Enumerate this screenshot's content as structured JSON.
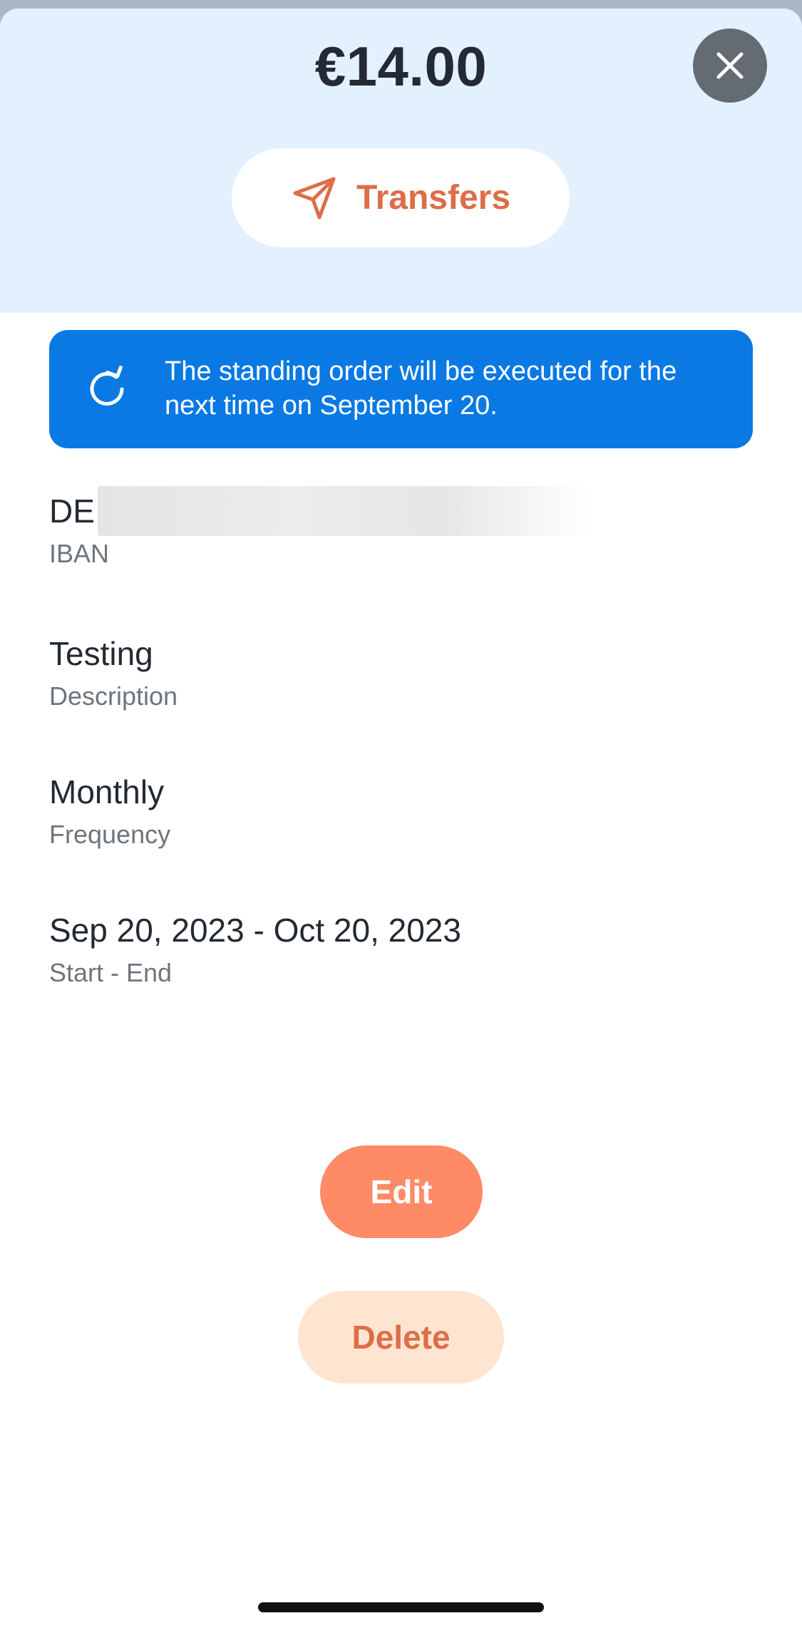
{
  "header": {
    "amount": "€14.00",
    "category_label": "Transfers",
    "category_icon": "paper-plane-icon",
    "close_icon": "close-icon"
  },
  "banner": {
    "icon": "refresh-icon",
    "text": "The standing order will be executed for the next time on September 20."
  },
  "fields": {
    "iban": {
      "value_prefix": "DE",
      "label": "IBAN"
    },
    "description": {
      "value": "Testing",
      "label": "Description"
    },
    "frequency": {
      "value": "Monthly",
      "label": "Frequency"
    },
    "period": {
      "value": "Sep 20, 2023 - Oct 20, 2023",
      "label": "Start - End"
    }
  },
  "actions": {
    "edit_label": "Edit",
    "delete_label": "Delete"
  },
  "colors": {
    "header_bg": "#e3f0fd",
    "banner_bg": "#0a79e3",
    "accent_orange": "#dd6e48",
    "edit_bg": "#fe8a66",
    "delete_bg": "#fee5d1",
    "close_bg": "#646b72"
  }
}
